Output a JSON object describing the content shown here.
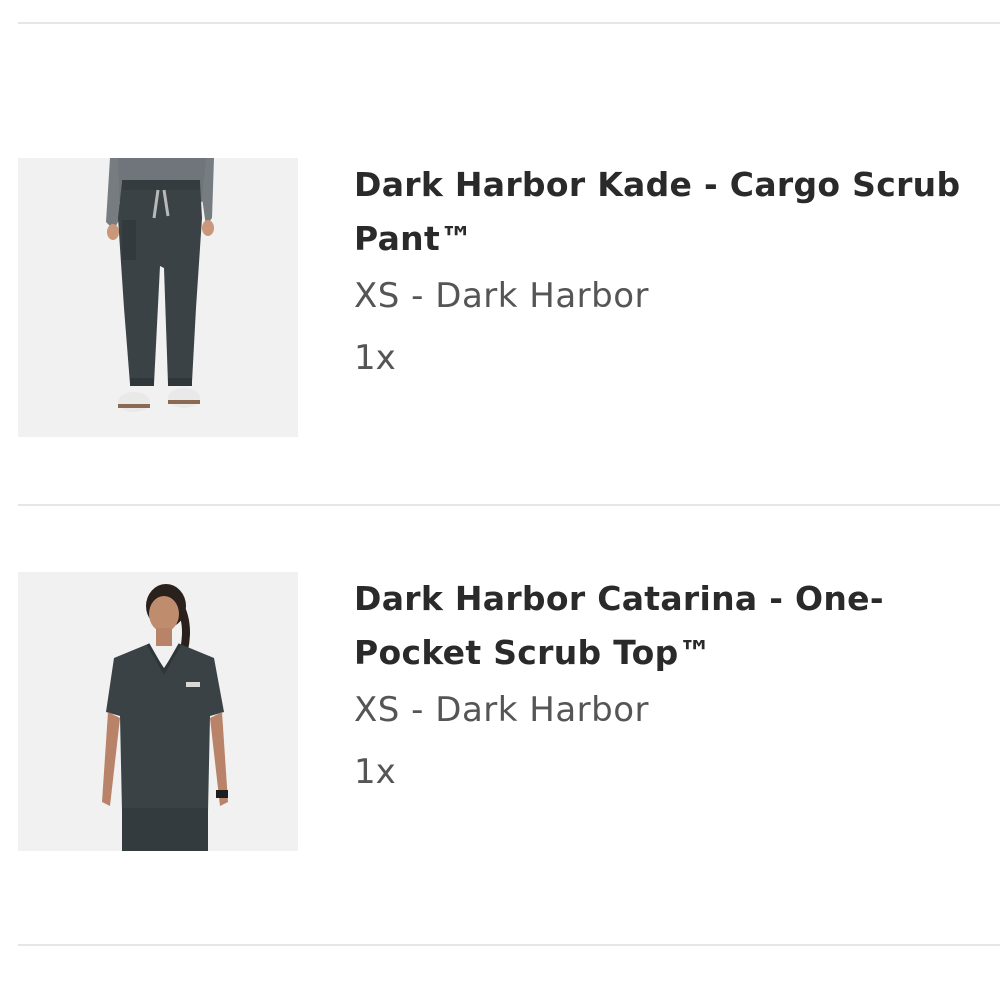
{
  "cart": {
    "items": [
      {
        "title": "Dark Harbor Kade - Cargo Scrub Pant™",
        "variant": "XS - Dark Harbor",
        "quantity": "1x",
        "image_icon": "scrub-pant-product-icon"
      },
      {
        "title": "Dark Harbor Catarina - One-Pocket Scrub Top™",
        "variant": "XS - Dark Harbor",
        "quantity": "1x",
        "image_icon": "scrub-top-product-icon"
      }
    ]
  },
  "colors": {
    "divider": "#e6e6e6",
    "title": "#2a2a2a",
    "secondary_text": "#555555",
    "thumb_background": "#f1f1f1",
    "product_color": "#3a4246"
  }
}
